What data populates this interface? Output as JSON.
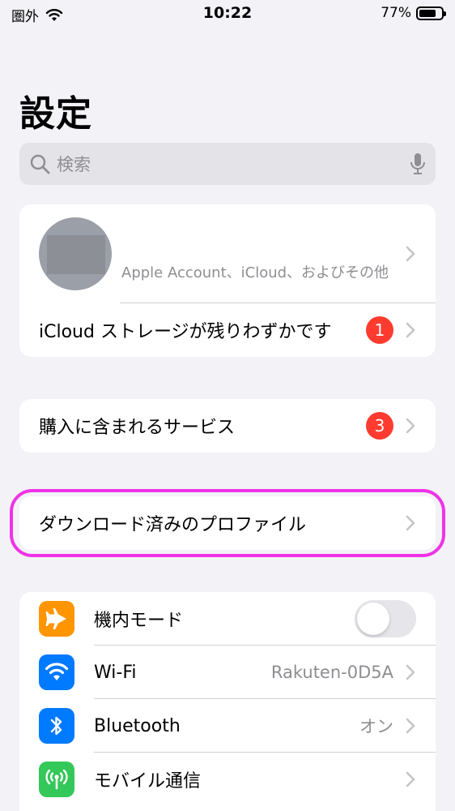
{
  "status_bar": {
    "carrier": "圏外",
    "time": "10:22",
    "battery": "77%",
    "battery_level": 0.77
  },
  "header": {
    "title": "設定"
  },
  "search": {
    "placeholder": "検索"
  },
  "account": {
    "subtitle": "Apple Account、iCloud、およびその他",
    "storage_label": "iCloud ストレージが残りわずかです",
    "storage_badge": "1"
  },
  "services": {
    "label": "購入に含まれるサービス",
    "badge": "3"
  },
  "profiles": {
    "label": "ダウンロード済みのプロファイル"
  },
  "settings": [
    {
      "label": "機内モード",
      "icon": "airplane-icon",
      "color": "#FF9500",
      "toggle": false
    },
    {
      "label": "Wi-Fi",
      "icon": "wifi-icon",
      "color": "#007AFF",
      "value": "Rakuten-0D5A"
    },
    {
      "label": "Bluetooth",
      "icon": "bluetooth-icon",
      "color": "#007AFF",
      "value": "オン"
    },
    {
      "label": "モバイル通信",
      "icon": "antenna-icon",
      "color": "#34C759"
    }
  ],
  "colors": {
    "highlight": "#F032E6",
    "badge": "#FF3B30"
  }
}
